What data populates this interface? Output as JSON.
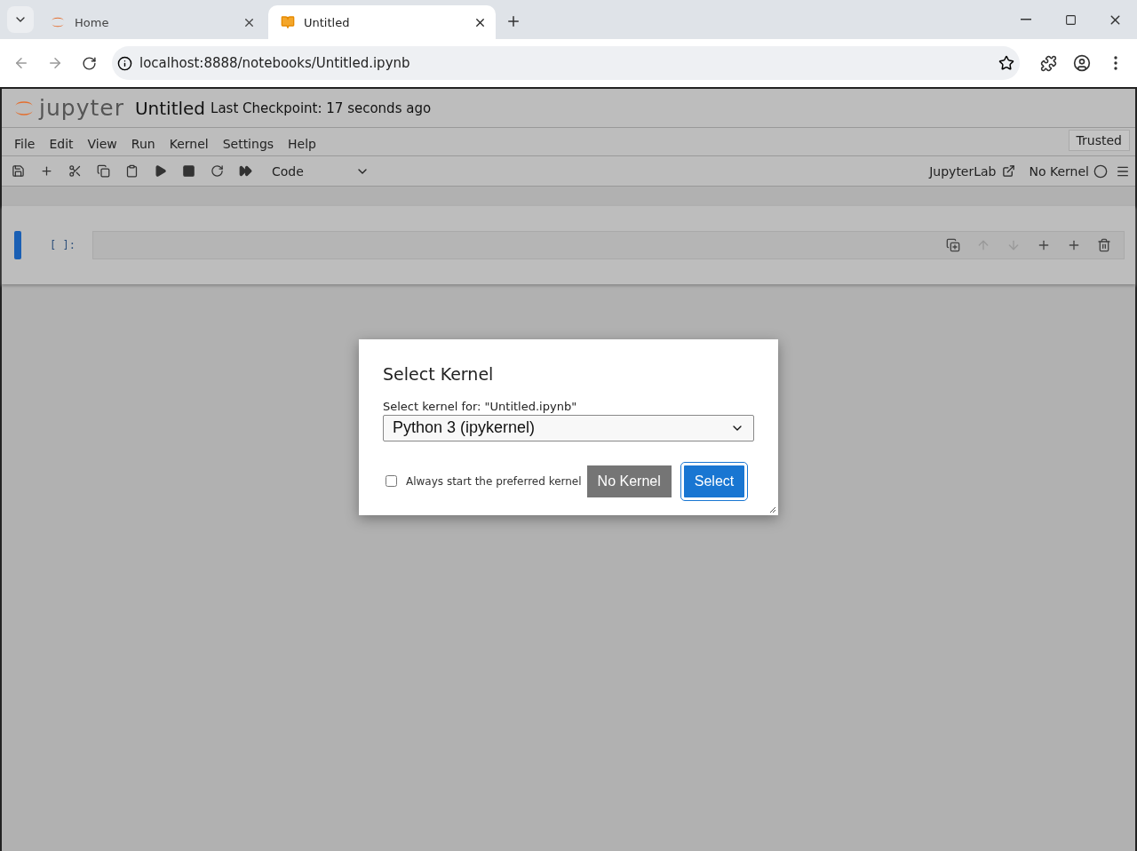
{
  "browser": {
    "tabs": [
      {
        "title": "Home",
        "kind": "jupyter",
        "selected": false
      },
      {
        "title": "Untitled",
        "kind": "notebook",
        "selected": true
      }
    ],
    "url": "localhost:8888/notebooks/Untitled.ipynb"
  },
  "notebook": {
    "logo": "jupyter",
    "title": "Untitled",
    "checkpoint": "Last Checkpoint: 17 seconds ago",
    "menu": [
      "File",
      "Edit",
      "View",
      "Run",
      "Kernel",
      "Settings",
      "Help"
    ],
    "trusted": "Trusted",
    "cell_type": "Code",
    "jupyterlab_link": "JupyterLab",
    "kernel_status": "No Kernel",
    "cell": {
      "prompt": "[ ]:"
    }
  },
  "dialog": {
    "title": "Select Kernel",
    "label": "Select kernel for: \"Untitled.ipynb\"",
    "kernel": "Python 3 (ipykernel)",
    "checkbox": {
      "label": "Always start the preferred kernel",
      "checked": false
    },
    "buttons": [
      {
        "label": "No Kernel",
        "kind": "secondary"
      },
      {
        "label": "Select",
        "kind": "primary"
      }
    ]
  }
}
